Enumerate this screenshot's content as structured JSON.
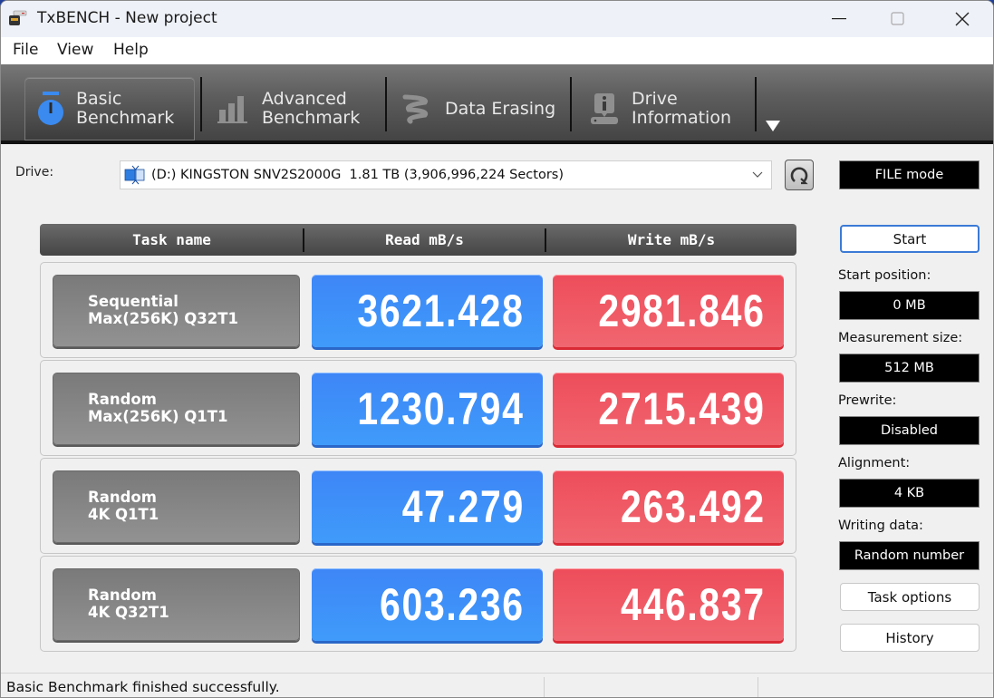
{
  "window": {
    "title": "TxBENCH - New project"
  },
  "menu": [
    "File",
    "View",
    "Help"
  ],
  "toolbar": {
    "tabs": [
      {
        "line1": "Basic",
        "line2": "Benchmark",
        "icon": "stopwatch-icon",
        "active": true
      },
      {
        "line1": "Advanced",
        "line2": "Benchmark",
        "icon": "bar-chart-icon",
        "active": false
      },
      {
        "line1": "Data Erasing",
        "line2": "",
        "icon": "eraser-icon",
        "active": false
      },
      {
        "line1": "Drive",
        "line2": "Information",
        "icon": "drive-info-icon",
        "active": false
      }
    ]
  },
  "drive": {
    "label": "Drive:",
    "selected": "(D:) KINGSTON SNV2S2000G  1.81 TB (3,906,996,224 Sectors)",
    "mode": "FILE mode"
  },
  "table": {
    "headers": [
      "Task name",
      "Read mB/s",
      "Write mB/s"
    ],
    "rows": [
      {
        "name1": "Sequential",
        "name2": "Max(256K) Q32T1",
        "read": "3621.428",
        "write": "2981.846"
      },
      {
        "name1": "Random",
        "name2": "Max(256K) Q1T1",
        "read": "1230.794",
        "write": "2715.439"
      },
      {
        "name1": "Random",
        "name2": "4K Q1T1",
        "read": "47.279",
        "write": "263.492"
      },
      {
        "name1": "Random",
        "name2": "4K Q32T1",
        "read": "603.236",
        "write": "446.837"
      }
    ]
  },
  "side": {
    "start_label": "Start",
    "start_position_label": "Start position:",
    "start_position_value": "0 MB",
    "measurement_size_label": "Measurement size:",
    "measurement_size_value": "512 MB",
    "prewrite_label": "Prewrite:",
    "prewrite_value": "Disabled",
    "alignment_label": "Alignment:",
    "alignment_value": "4 KB",
    "writing_data_label": "Writing data:",
    "writing_data_value": "Random number",
    "task_options_label": "Task options",
    "history_label": "History"
  },
  "status": {
    "message": "Basic Benchmark finished successfully."
  },
  "colors": {
    "read": "#3f8cf8",
    "write": "#ef5560",
    "accent_icon": "#3a8af0"
  }
}
